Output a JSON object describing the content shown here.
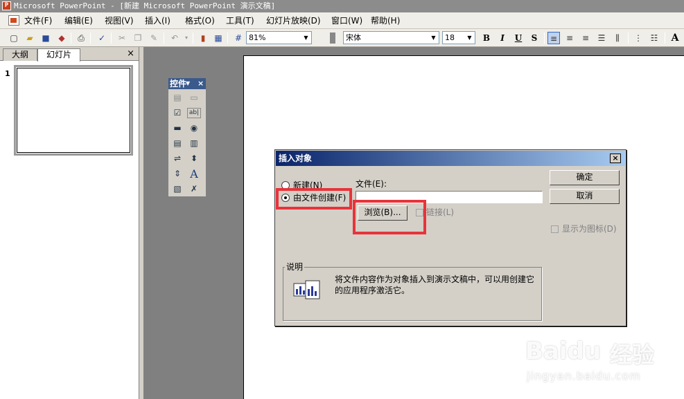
{
  "window": {
    "title": "Microsoft PowerPoint - [新建 Microsoft PowerPoint 演示文稿]"
  },
  "menu": {
    "items": [
      "文件(F)",
      "编辑(E)",
      "视图(V)",
      "插入(I)",
      "格式(O)",
      "工具(T)",
      "幻灯片放映(D)",
      "窗口(W)",
      "帮助(H)"
    ]
  },
  "toolbar": {
    "zoom": "81%",
    "font_name": "宋体",
    "font_size": "18",
    "bold": "B",
    "italic": "I",
    "underline": "U",
    "shadow": "S"
  },
  "outline_pane": {
    "tabs": [
      "大纲",
      "幻灯片"
    ],
    "close": "×",
    "slide_number": "1"
  },
  "controls_palette": {
    "title": "控件"
  },
  "dialog": {
    "title": "插入对象",
    "close": "×",
    "option_new": "新建(N)",
    "option_from_file": "由文件创建(F)",
    "file_label": "文件(E):",
    "file_value": "",
    "browse": "浏览(B)...",
    "link": "链接(L)",
    "ok": "确定",
    "cancel": "取消",
    "display_as_icon": "显示为图标(D)",
    "description_legend": "说明",
    "description": "将文件内容作为对象插入到演示文稿中，可以用创建它的应用程序激活它。"
  },
  "watermark": {
    "brand": "Baidu",
    "cn": "经验",
    "url": "jingyan.baidu.com"
  },
  "colors": {
    "highlight": "#e8333a",
    "dialog_title": "#0a246a"
  }
}
